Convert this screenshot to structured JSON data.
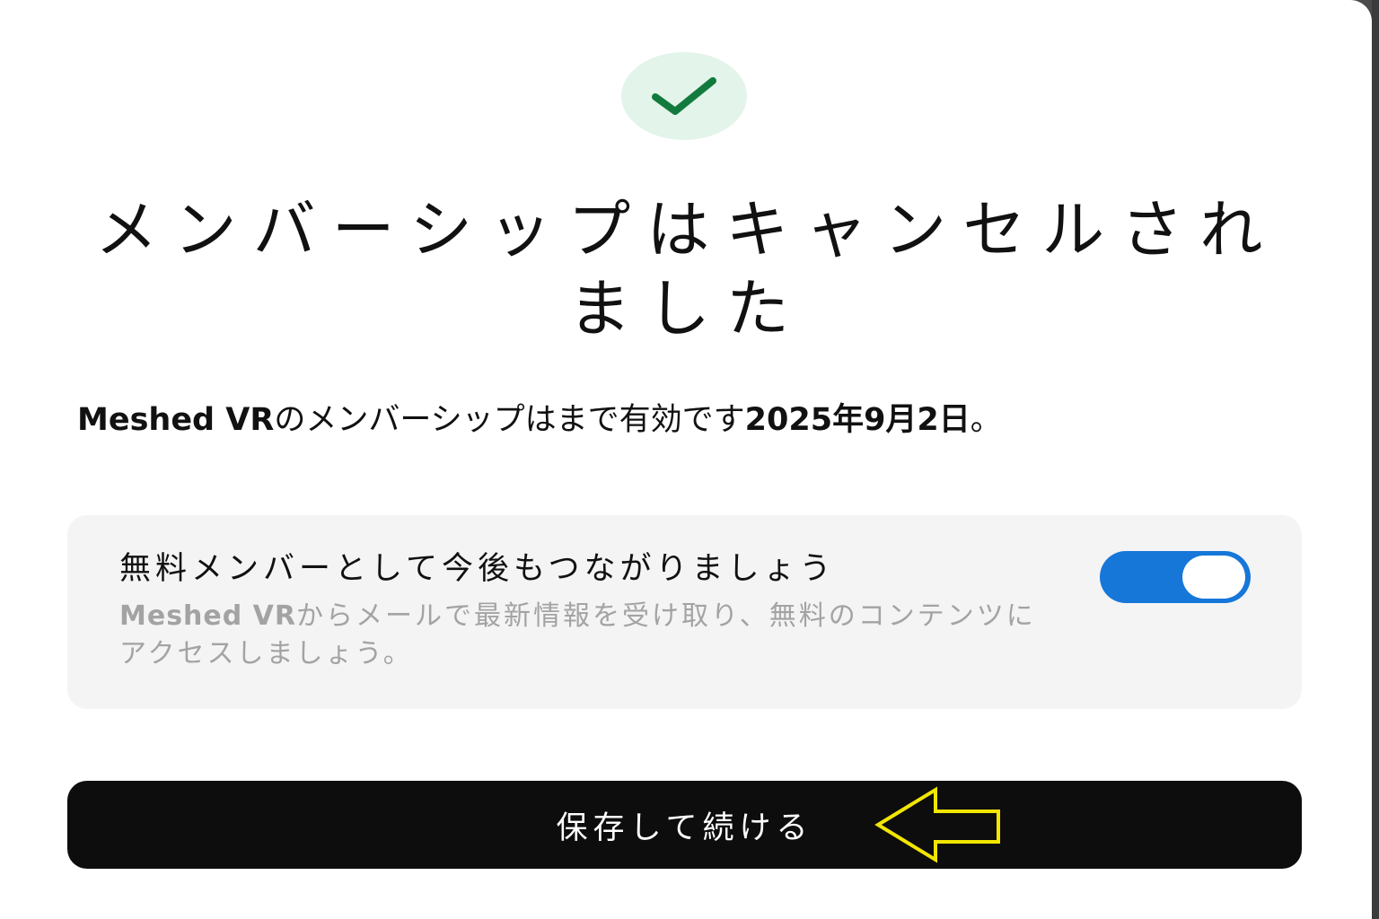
{
  "modal": {
    "icon": "check-icon",
    "title_line1": "メンバーシップはキャンセルされ",
    "title_line2": "ました",
    "subtitle": {
      "brand": "Meshed VR",
      "middle": "のメンバーシップはまで有効です",
      "date": "2025年9月2日",
      "end": "。"
    },
    "card": {
      "title": "無料メンバーとして今後もつながりましょう",
      "desc_brand": "Meshed VR",
      "desc_rest": "からメールで最新情報を受け取り、無料のコンテンツにアクセスしましょう。",
      "toggle_state": "on"
    },
    "primary_button": "保存して続ける"
  },
  "colors": {
    "check_badge_bg": "#e3f4ea",
    "check_color": "#137a3e",
    "toggle_on": "#1677d9",
    "button_bg": "#0d0d0d",
    "annotation_arrow": "#f2e600"
  }
}
